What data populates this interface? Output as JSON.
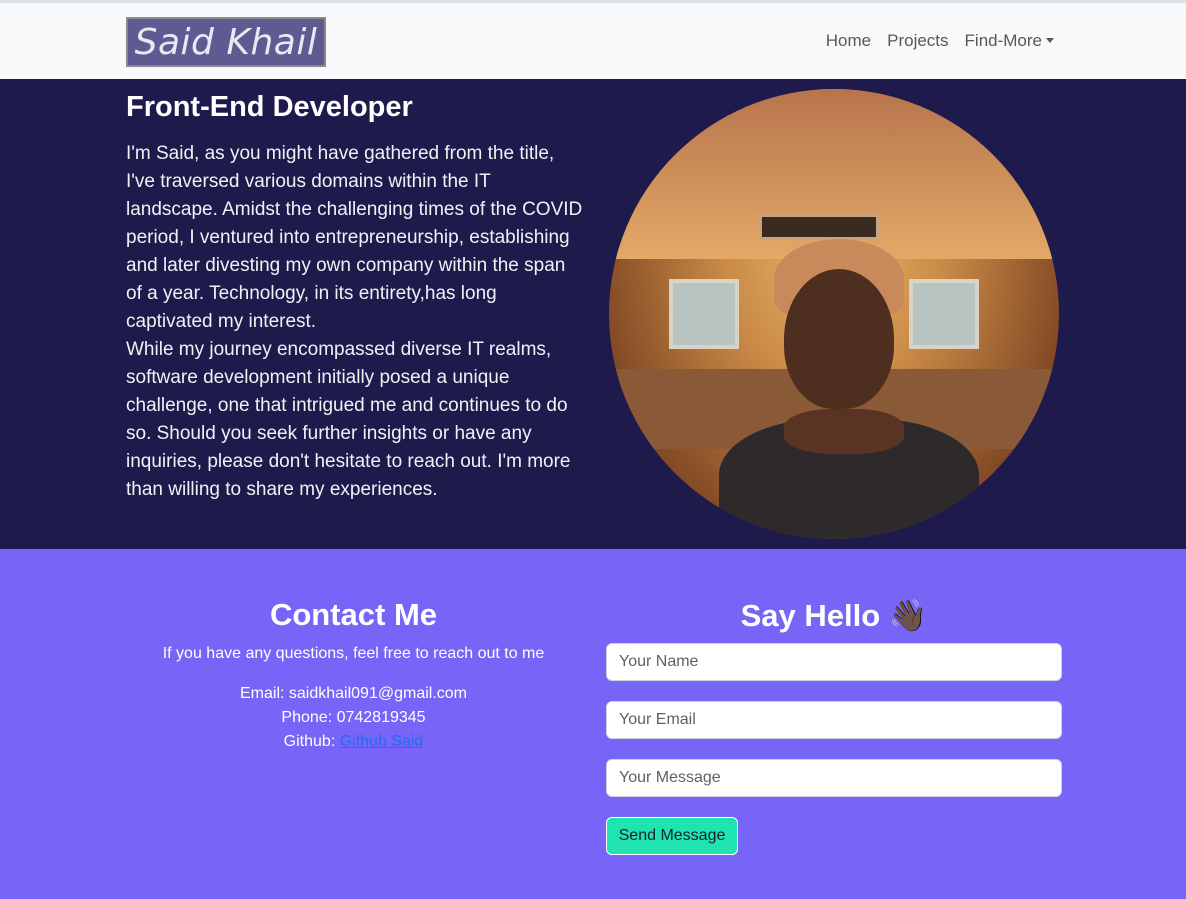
{
  "navbar": {
    "brand": "Said Khail",
    "links": [
      {
        "label": "Home"
      },
      {
        "label": "Projects"
      },
      {
        "label": "Find-More"
      }
    ]
  },
  "hero": {
    "title": "Front-End Developer",
    "paragraph1": "I'm Said, as you might have gathered from the title, I've traversed various domains within the IT landscape. Amidst the challenging times of the COVID period, I ventured into entrepreneurship, establishing and later divesting my own company within the span of a year. Technology, in its entirety,has long captivated my interest.",
    "paragraph2": "While my journey encompassed diverse IT realms, software development initially posed a unique challenge, one that intrigued me and continues to do so. Should you seek further insights or have any inquiries, please don't hesitate to reach out. I'm more than willing to share my experiences."
  },
  "contact": {
    "title": "Contact Me",
    "subtitle": "If you have any questions, feel free to reach out to me",
    "email_label": "Email: ",
    "email": "saidkhail091@gmail.com",
    "phone_label": "Phone: ",
    "phone": "0742819345",
    "github_label": "Github: ",
    "github_link": "Github Said"
  },
  "form": {
    "title": "Say Hello 👋🏿",
    "name_placeholder": "Your Name",
    "email_placeholder": "Your Email",
    "message_placeholder": "Your Message",
    "submit_label": "Send Message"
  },
  "colors": {
    "hero_bg": "#1e1a4c",
    "contact_bg": "#7765f7",
    "button_bg": "#20e3b2",
    "link": "#1d6ff2"
  }
}
